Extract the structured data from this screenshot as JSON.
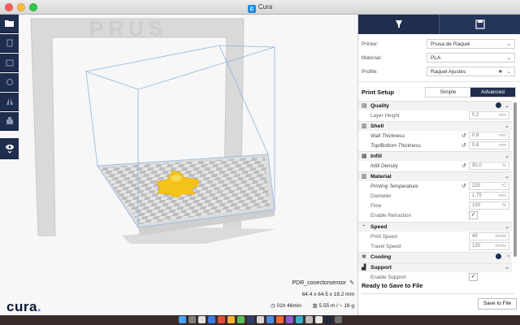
{
  "window": {
    "title": "Cura"
  },
  "left_toolbar": {
    "items": [
      {
        "icon": "folder-open-icon"
      },
      {
        "icon": "move-tool-icon"
      },
      {
        "icon": "scale-tool-icon"
      },
      {
        "icon": "rotate-tool-icon"
      },
      {
        "icon": "mirror-tool-icon"
      },
      {
        "icon": "per-model-settings-icon"
      },
      {
        "icon": "eye-view-icon"
      }
    ]
  },
  "model": {
    "name": "PDR_conectorsensor",
    "dimensions": "64.4 x 64.5 x 18.2 mm",
    "print_time": "01h 46min",
    "material_usage": "5.55 m / ~ 16 g"
  },
  "logo": {
    "text": "cura",
    "dot": "."
  },
  "sidebar": {
    "printer_label": "Printer:",
    "printer_value": "Prusa de Raquel",
    "material_label": "Material:",
    "material_value": "PLA",
    "profile_label": "Profile:",
    "profile_value": "Raquel Ajustes",
    "print_setup_label": "Print Setup",
    "mode_simple": "Simple",
    "mode_advanced": "Advanced",
    "ready_label": "Ready to Save to File",
    "save_button": "Save to File"
  },
  "settings": {
    "quality": "Quality",
    "layer_height": {
      "label": "Layer Height",
      "value": "0.2",
      "unit": "mm"
    },
    "shell": "Shell",
    "wall_thickness": {
      "label": "Wall Thickness",
      "value": "0.8",
      "unit": "mm"
    },
    "top_bottom_thickness": {
      "label": "Top/Bottom Thickness",
      "value": "0.8",
      "unit": "mm"
    },
    "infill": "Infill",
    "infill_density": {
      "label": "Infill Density",
      "value": "90.0",
      "unit": "%"
    },
    "material": "Material",
    "printing_temperature": {
      "label": "Printing Temperature",
      "value": "220",
      "unit": "°C"
    },
    "diameter": {
      "label": "Diameter",
      "value": "1.75",
      "unit": "mm"
    },
    "flow": {
      "label": "Flow",
      "value": "100",
      "unit": "%"
    },
    "enable_retraction": {
      "label": "Enable Retraction",
      "checked": true
    },
    "speed": "Speed",
    "print_speed": {
      "label": "Print Speed",
      "value": "40",
      "unit": "mm/s"
    },
    "travel_speed": {
      "label": "Travel Speed",
      "value": "120",
      "unit": "mm/s"
    },
    "cooling": "Cooling",
    "support": "Support",
    "enable_support": {
      "label": "Enable Support",
      "checked": true
    }
  },
  "colors": {
    "sidebar_dark": "#1f2e4d",
    "accent": "#3282ff",
    "model_yellow": "#f5c21b"
  }
}
